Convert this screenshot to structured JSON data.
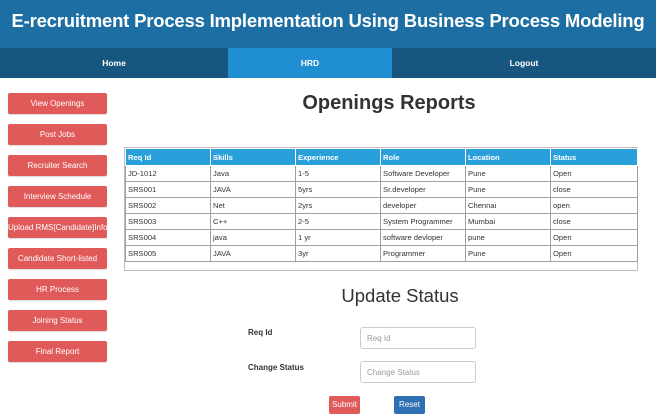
{
  "header": {
    "title": "E-recruitment Process Implementation Using Business Process Modeling"
  },
  "nav": {
    "home": "Home",
    "hrd": "HRD",
    "logout": "Logout"
  },
  "sidebar": {
    "items": [
      {
        "label": "View Openings"
      },
      {
        "label": "Post Jobs"
      },
      {
        "label": "Recruiter Search"
      },
      {
        "label": "Interview Schedule"
      },
      {
        "label": "Upload RMS[Candidate]Info"
      },
      {
        "label": "Candidate Short-listed"
      },
      {
        "label": "HR Process"
      },
      {
        "label": "Joining Status"
      },
      {
        "label": "Final Report"
      }
    ]
  },
  "main": {
    "title": "Openings Reports",
    "table": {
      "headers": [
        "Req Id",
        "Skills",
        "Experience",
        "Role",
        "Location",
        "Status"
      ],
      "rows": [
        [
          "JD-1012",
          "Java",
          "1-5",
          "Software Developer",
          "Pune",
          "Open"
        ],
        [
          "SRS001",
          "JAVA",
          "5yrs",
          "Sr.developer",
          "Pune",
          "close"
        ],
        [
          "SRS002",
          "Net",
          "2yrs",
          "developer",
          "Chennai",
          "open"
        ],
        [
          "SRS003",
          "C++",
          "2-5",
          "System Programmer",
          "Mumbai",
          "close"
        ],
        [
          "SRS004",
          "java",
          "1 yr",
          "software devloper",
          "pune",
          "Open"
        ],
        [
          "SRS005",
          "JAVA",
          "3yr",
          "Programmer",
          "Pune",
          "Open"
        ]
      ]
    }
  },
  "update": {
    "title": "Update Status",
    "req_id_label": "Req Id",
    "req_id_placeholder": "Req Id",
    "status_label": "Change Status",
    "status_placeholder": "Change Status",
    "submit": "Submit",
    "reset": "Reset"
  }
}
